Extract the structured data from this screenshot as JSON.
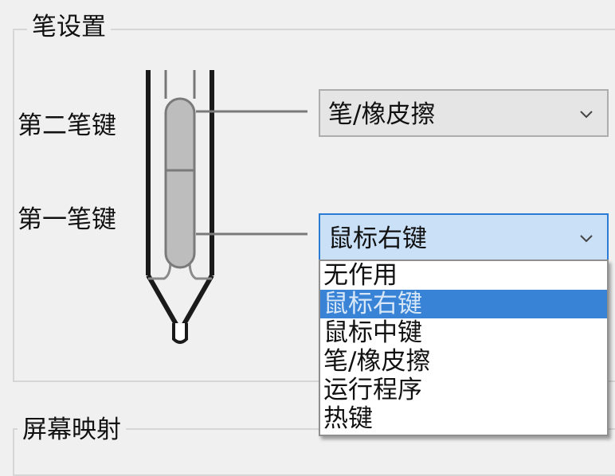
{
  "pen_settings": {
    "title": "笔设置",
    "second_button": {
      "label": "第二笔键",
      "value": "笔/橡皮擦"
    },
    "first_button": {
      "label": "第一笔键",
      "value": "鼠标右键"
    },
    "dropdown_options": [
      "无作用",
      "鼠标右键",
      "鼠标中键",
      "笔/橡皮擦",
      "运行程序",
      "热键"
    ],
    "selected_option": "鼠标右键"
  },
  "screen_mapping": {
    "title": "屏幕映射"
  },
  "icons": {
    "chevron": "chevron-down-icon",
    "pen": "pen-illustration"
  },
  "colors": {
    "window_bg": "#f0f0f0",
    "combo_focus_bg": "#c9e0f7",
    "combo_focus_border": "#2a7bd4",
    "selection_bg": "#3883d6"
  }
}
